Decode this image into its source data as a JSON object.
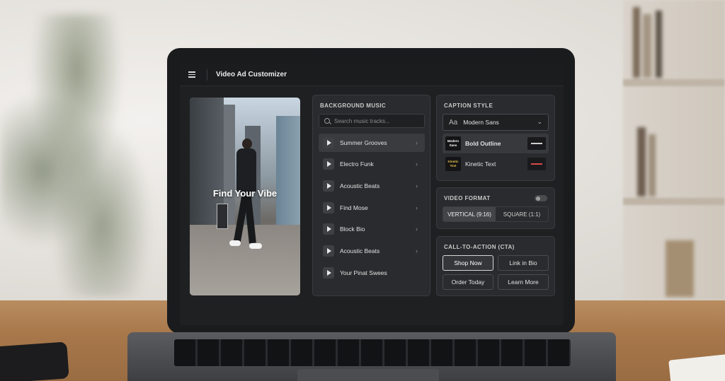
{
  "app": {
    "title": "Video Ad Customizer"
  },
  "preview": {
    "overlay_text": "Find Your Vibe"
  },
  "music": {
    "section_title": "BACKGROUND MUSIC",
    "search_placeholder": "Search music tracks...",
    "selected_index": 0,
    "tracks": [
      {
        "label": "Summer Grooves"
      },
      {
        "label": "Electro Funk"
      },
      {
        "label": "Acoustic Beats"
      },
      {
        "label": "Find Mose"
      },
      {
        "label": "Block Bio"
      },
      {
        "label": "Acoustic Beats"
      },
      {
        "label": "Your Pinat Swees"
      }
    ]
  },
  "caption": {
    "section_title": "CAPTION STYLE",
    "font_icon": "Aa",
    "selected_font": "Modern Sans",
    "options": [
      {
        "label": "Bold Outline",
        "thumb": "Modern Sans",
        "selected": true
      },
      {
        "label": "Kinetic Text",
        "thumb": "Kinetic Text",
        "selected": false
      }
    ]
  },
  "format": {
    "section_title": "VIDEO FORMAT",
    "toggle_on": false,
    "options": [
      "VERTICAL (9:16)",
      "SQUARE (1:1)"
    ],
    "active": "VERTICAL (9:16)"
  },
  "cta": {
    "section_title": "CALL-TO-ACTION (CTA)",
    "buttons": [
      "Shop Now",
      "Link in Bio",
      "Order Today",
      "Learn More"
    ],
    "active": "Shop Now"
  }
}
